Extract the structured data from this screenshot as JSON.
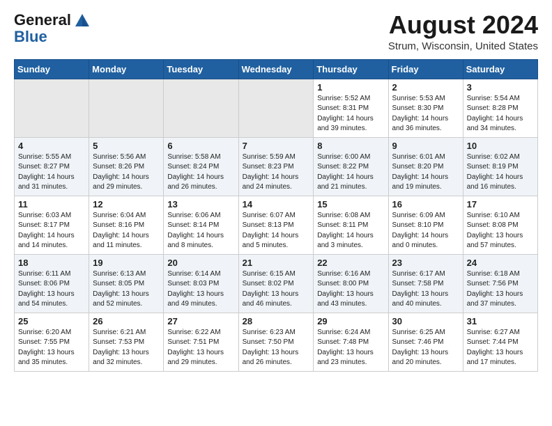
{
  "header": {
    "logo_general": "General",
    "logo_blue": "Blue",
    "month_title": "August 2024",
    "location": "Strum, Wisconsin, United States"
  },
  "weekdays": [
    "Sunday",
    "Monday",
    "Tuesday",
    "Wednesday",
    "Thursday",
    "Friday",
    "Saturday"
  ],
  "weeks": [
    [
      {
        "day": "",
        "info": ""
      },
      {
        "day": "",
        "info": ""
      },
      {
        "day": "",
        "info": ""
      },
      {
        "day": "",
        "info": ""
      },
      {
        "day": "1",
        "info": "Sunrise: 5:52 AM\nSunset: 8:31 PM\nDaylight: 14 hours\nand 39 minutes."
      },
      {
        "day": "2",
        "info": "Sunrise: 5:53 AM\nSunset: 8:30 PM\nDaylight: 14 hours\nand 36 minutes."
      },
      {
        "day": "3",
        "info": "Sunrise: 5:54 AM\nSunset: 8:28 PM\nDaylight: 14 hours\nand 34 minutes."
      }
    ],
    [
      {
        "day": "4",
        "info": "Sunrise: 5:55 AM\nSunset: 8:27 PM\nDaylight: 14 hours\nand 31 minutes."
      },
      {
        "day": "5",
        "info": "Sunrise: 5:56 AM\nSunset: 8:26 PM\nDaylight: 14 hours\nand 29 minutes."
      },
      {
        "day": "6",
        "info": "Sunrise: 5:58 AM\nSunset: 8:24 PM\nDaylight: 14 hours\nand 26 minutes."
      },
      {
        "day": "7",
        "info": "Sunrise: 5:59 AM\nSunset: 8:23 PM\nDaylight: 14 hours\nand 24 minutes."
      },
      {
        "day": "8",
        "info": "Sunrise: 6:00 AM\nSunset: 8:22 PM\nDaylight: 14 hours\nand 21 minutes."
      },
      {
        "day": "9",
        "info": "Sunrise: 6:01 AM\nSunset: 8:20 PM\nDaylight: 14 hours\nand 19 minutes."
      },
      {
        "day": "10",
        "info": "Sunrise: 6:02 AM\nSunset: 8:19 PM\nDaylight: 14 hours\nand 16 minutes."
      }
    ],
    [
      {
        "day": "11",
        "info": "Sunrise: 6:03 AM\nSunset: 8:17 PM\nDaylight: 14 hours\nand 14 minutes."
      },
      {
        "day": "12",
        "info": "Sunrise: 6:04 AM\nSunset: 8:16 PM\nDaylight: 14 hours\nand 11 minutes."
      },
      {
        "day": "13",
        "info": "Sunrise: 6:06 AM\nSunset: 8:14 PM\nDaylight: 14 hours\nand 8 minutes."
      },
      {
        "day": "14",
        "info": "Sunrise: 6:07 AM\nSunset: 8:13 PM\nDaylight: 14 hours\nand 5 minutes."
      },
      {
        "day": "15",
        "info": "Sunrise: 6:08 AM\nSunset: 8:11 PM\nDaylight: 14 hours\nand 3 minutes."
      },
      {
        "day": "16",
        "info": "Sunrise: 6:09 AM\nSunset: 8:10 PM\nDaylight: 14 hours\nand 0 minutes."
      },
      {
        "day": "17",
        "info": "Sunrise: 6:10 AM\nSunset: 8:08 PM\nDaylight: 13 hours\nand 57 minutes."
      }
    ],
    [
      {
        "day": "18",
        "info": "Sunrise: 6:11 AM\nSunset: 8:06 PM\nDaylight: 13 hours\nand 54 minutes."
      },
      {
        "day": "19",
        "info": "Sunrise: 6:13 AM\nSunset: 8:05 PM\nDaylight: 13 hours\nand 52 minutes."
      },
      {
        "day": "20",
        "info": "Sunrise: 6:14 AM\nSunset: 8:03 PM\nDaylight: 13 hours\nand 49 minutes."
      },
      {
        "day": "21",
        "info": "Sunrise: 6:15 AM\nSunset: 8:02 PM\nDaylight: 13 hours\nand 46 minutes."
      },
      {
        "day": "22",
        "info": "Sunrise: 6:16 AM\nSunset: 8:00 PM\nDaylight: 13 hours\nand 43 minutes."
      },
      {
        "day": "23",
        "info": "Sunrise: 6:17 AM\nSunset: 7:58 PM\nDaylight: 13 hours\nand 40 minutes."
      },
      {
        "day": "24",
        "info": "Sunrise: 6:18 AM\nSunset: 7:56 PM\nDaylight: 13 hours\nand 37 minutes."
      }
    ],
    [
      {
        "day": "25",
        "info": "Sunrise: 6:20 AM\nSunset: 7:55 PM\nDaylight: 13 hours\nand 35 minutes."
      },
      {
        "day": "26",
        "info": "Sunrise: 6:21 AM\nSunset: 7:53 PM\nDaylight: 13 hours\nand 32 minutes."
      },
      {
        "day": "27",
        "info": "Sunrise: 6:22 AM\nSunset: 7:51 PM\nDaylight: 13 hours\nand 29 minutes."
      },
      {
        "day": "28",
        "info": "Sunrise: 6:23 AM\nSunset: 7:50 PM\nDaylight: 13 hours\nand 26 minutes."
      },
      {
        "day": "29",
        "info": "Sunrise: 6:24 AM\nSunset: 7:48 PM\nDaylight: 13 hours\nand 23 minutes."
      },
      {
        "day": "30",
        "info": "Sunrise: 6:25 AM\nSunset: 7:46 PM\nDaylight: 13 hours\nand 20 minutes."
      },
      {
        "day": "31",
        "info": "Sunrise: 6:27 AM\nSunset: 7:44 PM\nDaylight: 13 hours\nand 17 minutes."
      }
    ]
  ]
}
